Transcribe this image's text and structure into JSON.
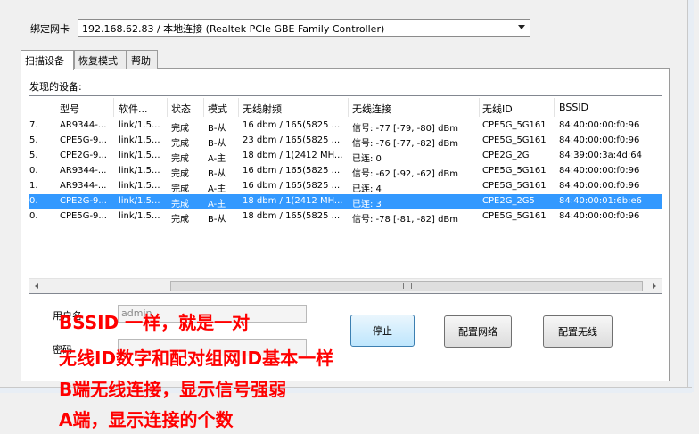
{
  "bind_card": {
    "label": "绑定网卡",
    "selected": "192.168.62.83 / 本地连接 (Realtek PCIe GBE Family Controller)"
  },
  "tabs": [
    {
      "label": "扫描设备",
      "active": true
    },
    {
      "label": "恢复模式",
      "active": false
    },
    {
      "label": "帮助",
      "active": false
    }
  ],
  "found_label": "发现的设备:",
  "table": {
    "headers": [
      "型号",
      "软件...",
      "状态",
      "模式",
      "无线射频",
      "无线连接",
      "无线ID",
      "BSSID"
    ],
    "rows": [
      {
        "c0": "7.",
        "c1": "AR9344-...",
        "c2": "link/1.5...",
        "c3": "完成",
        "c4": "B-从",
        "c5": "16 dbm / 165(5825 ...",
        "c6": "信号: -77 [-79, -80] dBm",
        "c7": "CPE5G_5G161",
        "c8": "84:40:00:00:f0:96",
        "selected": false
      },
      {
        "c0": "5.",
        "c1": "CPE5G-9...",
        "c2": "link/1.5...",
        "c3": "完成",
        "c4": "B-从",
        "c5": "23 dbm / 165(5825 ...",
        "c6": "信号: -76 [-77, -82] dBm",
        "c7": "CPE5G_5G161",
        "c8": "84:40:00:00:f0:96",
        "selected": false
      },
      {
        "c0": "5.",
        "c1": "CPE2G-9...",
        "c2": "link/1.5...",
        "c3": "完成",
        "c4": "A-主",
        "c5": "18 dbm / 1(2412 MH...",
        "c6": "已连: 0",
        "c7": "CPE2G_2G",
        "c8": "84:39:00:3a:4d:64",
        "selected": false
      },
      {
        "c0": "0.",
        "c1": "AR9344-...",
        "c2": "link/1.5...",
        "c3": "完成",
        "c4": "B-从",
        "c5": "16 dbm / 165(5825 ...",
        "c6": "信号: -62 [-92, -62] dBm",
        "c7": "CPE5G_5G161",
        "c8": "84:40:00:00:f0:96",
        "selected": false
      },
      {
        "c0": "1.",
        "c1": "AR9344-...",
        "c2": "link/1.5...",
        "c3": "完成",
        "c4": "A-主",
        "c5": "16 dbm / 165(5825 ...",
        "c6": "已连: 4",
        "c7": "CPE5G_5G161",
        "c8": "84:40:00:00:f0:96",
        "selected": false
      },
      {
        "c0": "0.",
        "c1": "CPE2G-9...",
        "c2": "link/1.5...",
        "c3": "完成",
        "c4": "A-主",
        "c5": "18 dbm / 1(2412 MH...",
        "c6": "已连: 3",
        "c7": "CPE2G_2G5",
        "c8": "84:40:00:01:6b:e6",
        "selected": true
      },
      {
        "c0": "0.",
        "c1": "CPE5G-9...",
        "c2": "link/1.5...",
        "c3": "完成",
        "c4": "B-从",
        "c5": "18 dbm / 165(5825 ...",
        "c6": "信号: -78 [-81, -82] dBm",
        "c7": "CPE5G_5G161",
        "c8": "84:40:00:00:f0:96",
        "selected": false
      }
    ],
    "scroll_grip": "III"
  },
  "form": {
    "username_label": "用户名",
    "username_value": "admin",
    "password_label": "密码"
  },
  "buttons": {
    "stop": "停止",
    "config_network": "配置网络",
    "config_wireless": "配置无线"
  },
  "annotations": [
    "BSSID 一样，就是一对",
    "无线ID数字和配对组网ID基本一样",
    "B端无线连接，显示信号强弱",
    "A端，显示连接的个数"
  ],
  "colors": {
    "selection": "#3399ff",
    "annotation": "#ff0000"
  }
}
